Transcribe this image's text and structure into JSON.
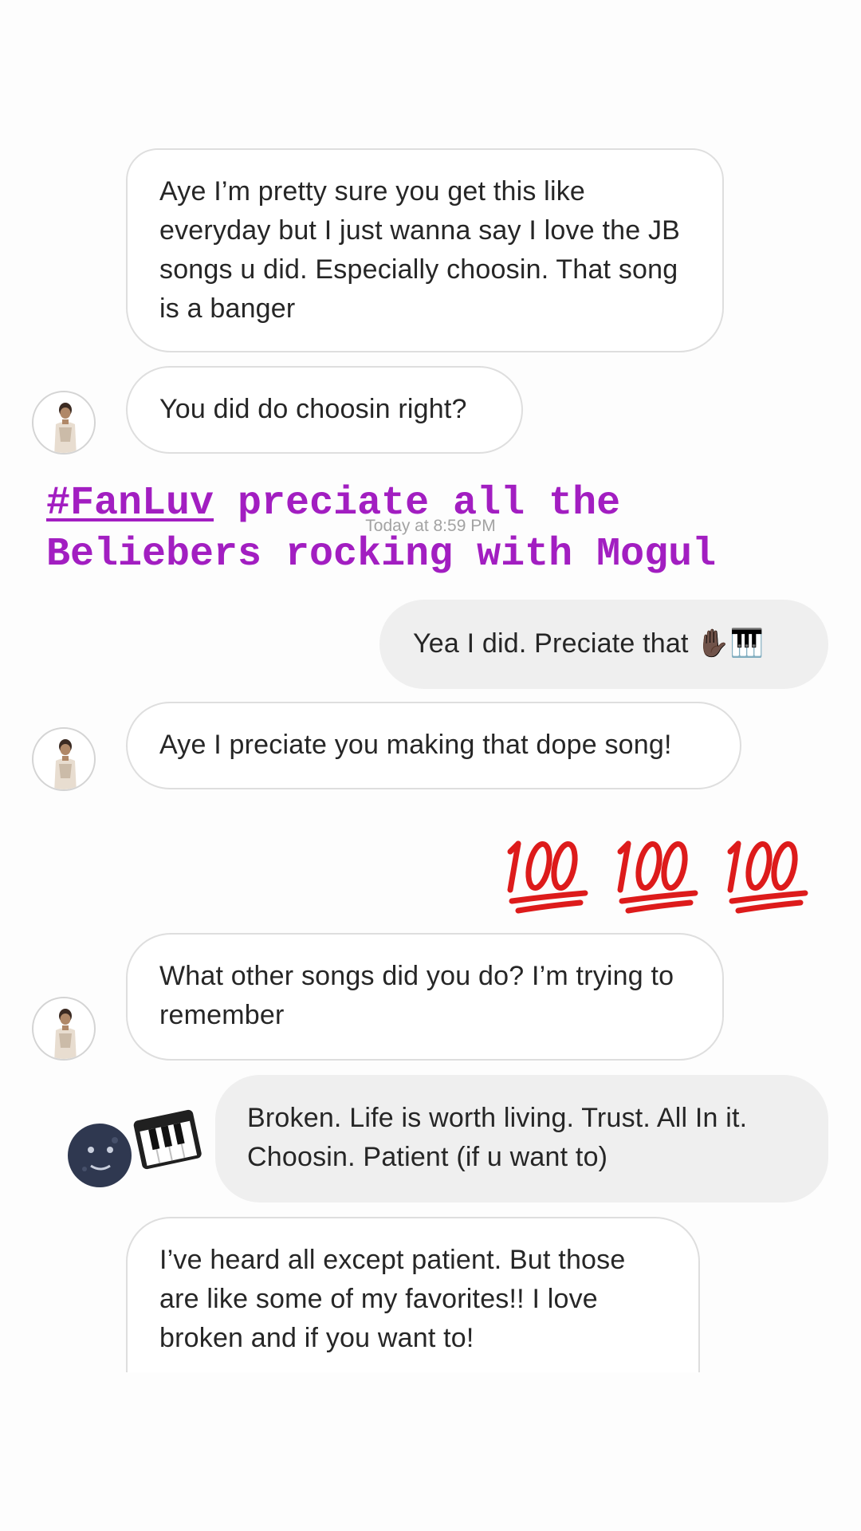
{
  "messages": [
    {
      "text": "Aye I’m pretty sure you get this like everyday but I just wanna say I love the JB songs u did. Especially choosin. That song is a banger"
    },
    {
      "text": "You did do choosin right?"
    },
    {
      "text": "Yea I did. Preciate that ✋🏿🎹"
    },
    {
      "text": "Aye I preciate you making that dope song!"
    },
    {
      "text": "💯💯💯"
    },
    {
      "text": "What other songs did you do? I’m trying to remember"
    },
    {
      "text": "Broken. Life is worth living. Trust. All In it. Choosin. Patient (if u want to)"
    },
    {
      "text": "I’ve heard all except patient. But those are like some of my favorites!! I love broken and if you want to!"
    }
  ],
  "timestamp": "Today at 8:59 PM",
  "caption": {
    "hashtag": "#FanLuv",
    "line1_rest": " preciate all the",
    "line2": "Beliebers rocking with Mogul"
  },
  "reactions": {
    "hundred": "100",
    "moon": "🌚",
    "piano": "🎹"
  },
  "colors": {
    "caption": "#a21ec1",
    "received_bubble_border": "#dedede",
    "sent_bubble": "#efefef",
    "timestamp": "#a3a3a3"
  },
  "icons": [
    "avatar-photo",
    "raised-hand-emoji",
    "piano-emoji",
    "hundred-points-emoji",
    "new-moon-face-emoji"
  ]
}
